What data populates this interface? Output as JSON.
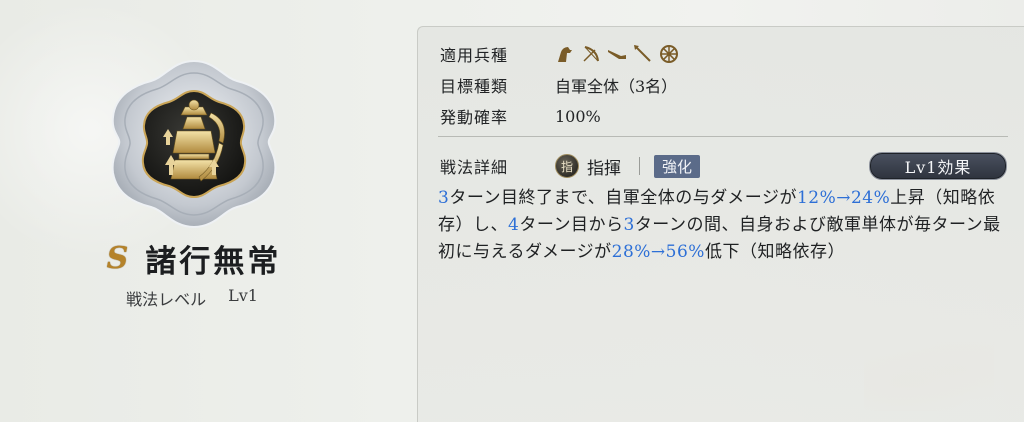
{
  "skill": {
    "grade": "S",
    "name": "諸行無常",
    "level_label": "戦法レベル",
    "level_value": "Lv1",
    "emblem_icon": "samurai-armor-emblem-icon"
  },
  "info": {
    "troop_label": "適用兵種",
    "troop_icons": [
      "cavalry-icon",
      "bow-icon",
      "gun-icon",
      "spear-icon",
      "siege-wheel-icon"
    ],
    "target_label": "目標種類",
    "target_value": "自軍全体（3名）",
    "rate_label": "発動確率",
    "rate_value": "100%"
  },
  "detail": {
    "label": "戦法詳細",
    "type_icon_text": "指",
    "type_label": "指揮",
    "enhance_label": "強化",
    "level_button": "Lv1効果",
    "description": [
      {
        "t": "3",
        "hl": true
      },
      {
        "t": "ターン目終了まで、自軍全体の与ダメージが",
        "hl": false
      },
      {
        "t": "12%→24%",
        "hl": true
      },
      {
        "t": "上昇（知略依存）し、",
        "hl": false
      },
      {
        "t": "4",
        "hl": true
      },
      {
        "t": "ターン目から",
        "hl": false
      },
      {
        "t": "3",
        "hl": true
      },
      {
        "t": "ターンの間、自身および敵軍単体が毎ターン最初に与えるダメージが",
        "hl": false
      },
      {
        "t": "28%→56%",
        "hl": true
      },
      {
        "t": "低下（知略依存）",
        "hl": false
      }
    ]
  },
  "colors": {
    "highlight": "#2d6fd6",
    "grade": "#b5832a",
    "enhance": "#5b6b89"
  }
}
